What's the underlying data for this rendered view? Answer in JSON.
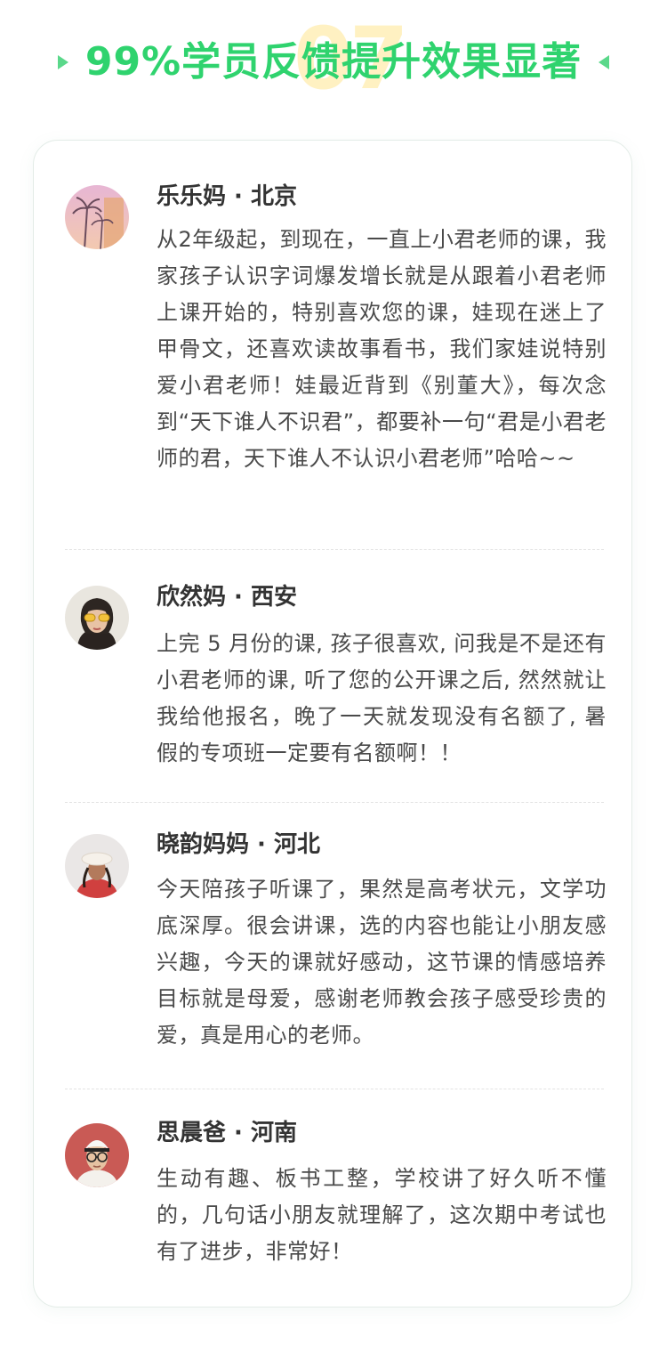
{
  "header": {
    "title": "99%学员反馈提升效果显著",
    "ghost_number": "07",
    "accent_color": "#2fd36e"
  },
  "reviews": [
    {
      "name": "乐乐妈 · 北京",
      "avatar": "avatar-palm-trees",
      "text": "从2年级起，到现在，一直上小君老师的课，我家孩子认识字词爆发增长就是从跟着小君老师上课开始的，特别喜欢您的课，娃现在迷上了甲骨文，还喜欢读故事看书，我们家娃说特别爱小君老师！娃最近背到《别董大》，每次念到“天下谁人不识君”，都要补一句“君是小君老师的君，天下谁人不认识小君老师”哈哈~~"
    },
    {
      "name": "欣然妈 ·  西安",
      "avatar": "avatar-woman-sunglasses",
      "text": "上完 5 月份的课, 孩子很喜欢, 问我是不是还有小君老师的课, 听了您的公开课之后, 然然就让我给他报名，晚了一天就发现没有名额了, 暑假的专项班一定要有名额啊！！"
    },
    {
      "name": "晓韵妈妈 · 河北",
      "avatar": "avatar-beret",
      "text": "今天陪孩子听课了，果然是高考状元，文学功底深厚。很会讲课，选的内容也能让小朋友感兴趣，今天的课就好感动，这节课的情感培养目标就是母爱，感谢老师教会孩子感受珍贵的爱，真是用心的老师。"
    },
    {
      "name": "思晨爸 · 河南",
      "avatar": "avatar-man-glasses",
      "text": "生动有趣、板书工整，学校讲了好久听不懂的，几句话小朋友就理解了，这次期中考试也有了进步，非常好！"
    }
  ]
}
